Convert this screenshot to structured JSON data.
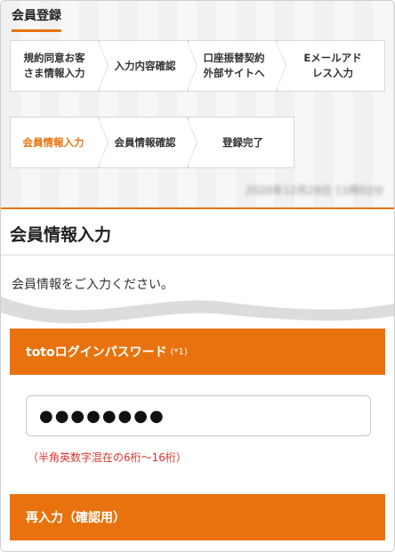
{
  "header": {
    "title": "会員登録"
  },
  "steps_row1": [
    {
      "label": "規約同意お客さま情報入力",
      "active": false
    },
    {
      "label": "入力内容確認",
      "active": false
    },
    {
      "label": "口座振替契約外部サイトへ",
      "active": false
    },
    {
      "label": "Eメールアドレス入力",
      "active": false
    }
  ],
  "steps_row2": [
    {
      "label": "会員情報入力",
      "active": true
    },
    {
      "label": "会員情報確認",
      "active": false
    },
    {
      "label": "登録完了",
      "active": false
    }
  ],
  "timestamp": "2020年12月29日 11時02分",
  "main": {
    "title": "会員情報入力",
    "lead": "会員情報をご入力ください。"
  },
  "password_section": {
    "label": "totoログインパスワード",
    "note": "(*1)",
    "value": "●●●●●●●●",
    "hint": "（半角英数字混在の6桁〜16桁）"
  },
  "confirm_section": {
    "label": "再入力（確認用）"
  },
  "colors": {
    "accent": "#e8730e",
    "error": "#d8332c"
  }
}
